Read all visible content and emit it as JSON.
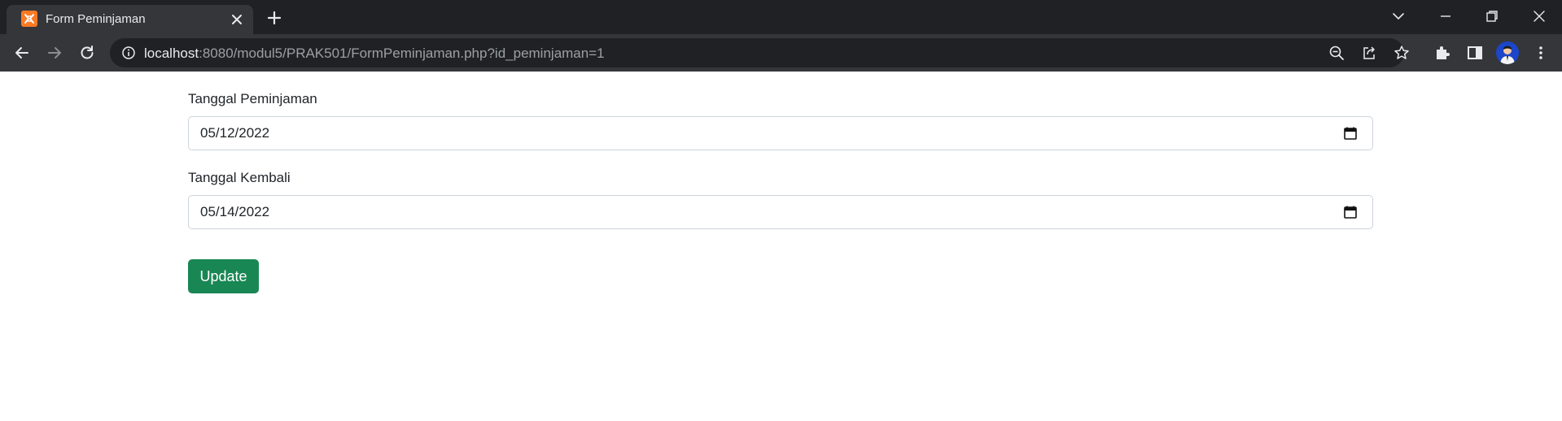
{
  "browser": {
    "tab": {
      "title": "Form Peminjaman",
      "favicon": "xampp-icon"
    },
    "url": {
      "host": "localhost",
      "path": ":8080/modul5/PRAK501/FormPeminjaman.php?id_peminjaman=1"
    },
    "colors": {
      "frame": "#202124",
      "toolbar": "#35363a",
      "favicon": "#fb7a24"
    }
  },
  "form": {
    "tanggal_peminjaman": {
      "label": "Tanggal Peminjaman",
      "value": "05/12/2022"
    },
    "tanggal_kembali": {
      "label": "Tanggal Kembali",
      "value": "05/14/2022"
    },
    "submit_label": "Update",
    "colors": {
      "button": "#198754"
    }
  }
}
